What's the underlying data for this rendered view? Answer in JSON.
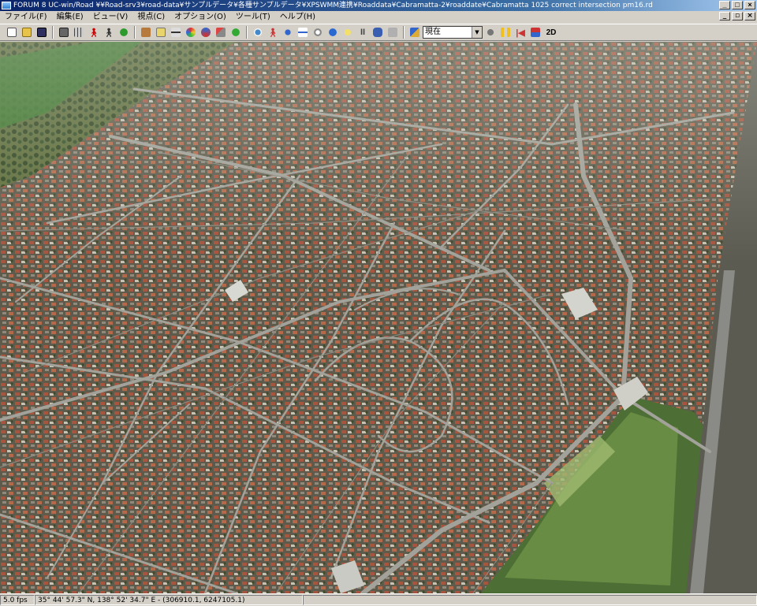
{
  "window": {
    "title": "FORUM 8   UC-win/Road   ¥¥Road-srv3¥road-data¥サンプルデータ¥各種サンプルデータ¥XPSWMM連携¥Roaddata¥Cabramatta-2¥roaddate¥Cabramatta 1025 correct intersection pm16.rd",
    "minimize": "_",
    "maximize": "□",
    "close": "×"
  },
  "menu": [
    {
      "label": "ファイル(F)"
    },
    {
      "label": "編集(E)"
    },
    {
      "label": "ビュー(V)"
    },
    {
      "label": "視点(C)"
    },
    {
      "label": "オプション(O)"
    },
    {
      "label": "ツール(T)"
    },
    {
      "label": "ヘルプ(H)"
    }
  ],
  "mdi": {
    "minimize": "_",
    "restore": "▫",
    "close": "×"
  },
  "toolbar": {
    "view_select": "現在",
    "mode_2d": "2D"
  },
  "status": {
    "fps": "5.0 fps",
    "coords": "35°  44' 57.3\" N, 138°  52' 34.7\" E  -  (306910.1, 6247105.1)"
  },
  "colors": {
    "title_start": "#0a246a",
    "title_end": "#a6caf0",
    "chrome": "#d4d0c8",
    "roads": "#9a9a92"
  }
}
